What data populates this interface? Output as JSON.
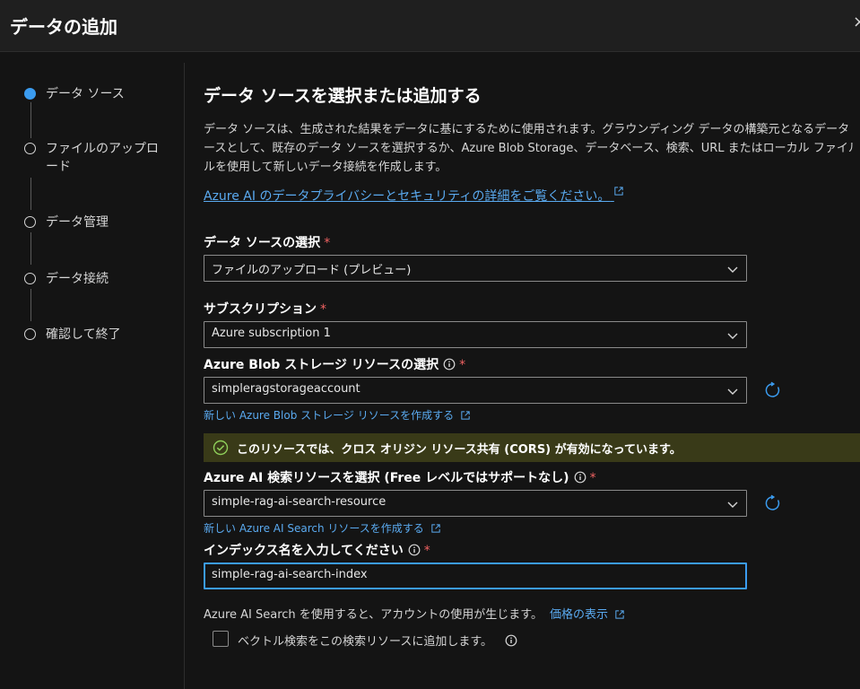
{
  "header": {
    "title": "データの追加",
    "close_label": "×"
  },
  "steps": [
    {
      "label": "データ ソース",
      "active": true
    },
    {
      "label": "ファイルのアップロード",
      "active": false
    },
    {
      "label": "データ管理",
      "active": false
    },
    {
      "label": "データ接続",
      "active": false
    },
    {
      "label": "確認して終了",
      "active": false
    }
  ],
  "main": {
    "title": "データ ソースを選択または追加する",
    "description_lines": [
      "データ ソースは、生成された結果をデータに基にするために使用されます。グラウンディング データの構築元となるデータ ソ",
      "ースとして、既存のデータ ソースを選択するか、Azure Blob Storage、データベース、検索、URL またはローカル ファイル",
      "ルを使用して新しいデータ接続を作成します。"
    ],
    "privacy_link": "Azure AI のデータプライバシーとセキュリティの詳細をご覧ください。",
    "data_source": {
      "label": "データ ソースの選択",
      "value": "ファイルのアップロード (プレビュー)"
    },
    "subscription": {
      "label": "サブスクリプション",
      "value": "Azure subscription 1"
    },
    "blob": {
      "label": "Azure Blob ストレージ リソースの選択",
      "value": "simpleragstorageaccount",
      "create_link": "新しい Azure Blob ストレージ リソースを作成する"
    },
    "cors_message": "このリソースでは、クロス オリジン リソース共有 (CORS) が有効になっています。",
    "search": {
      "label": "Azure AI 検索リソースを選択 (Free レベルではサポートなし)",
      "value": "simple-rag-ai-search-resource",
      "create_link": "新しい Azure AI Search リソースを作成する"
    },
    "index": {
      "label": "インデックス名を入力してください",
      "value": "simple-rag-ai-search-index"
    },
    "usage_note": "Azure AI Search を使用すると、アカウントの使用が生じます。",
    "price_link": "価格の表示",
    "vector_checkbox": {
      "label": "ベクトル検索をこの検索リソースに追加します。",
      "checked": false
    },
    "required_mark": "*"
  },
  "colors": {
    "accent": "#3b9cf0",
    "link": "#5aaaf0",
    "required": "#f06262",
    "banner_bg": "#393a18"
  }
}
